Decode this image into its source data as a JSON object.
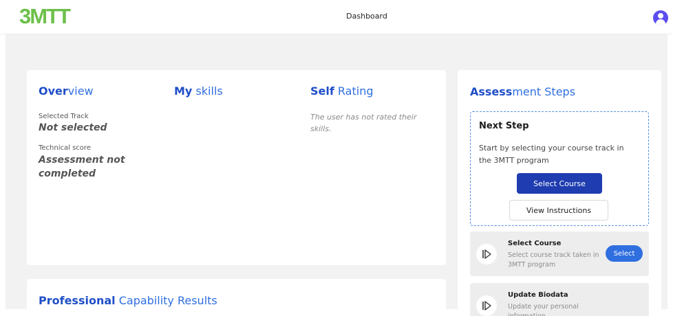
{
  "header": {
    "logo_text": "3MTT",
    "title": "Dashboard",
    "brand_color": "#6cc04a",
    "avatar_icon": "user-avatar-icon"
  },
  "overview": {
    "title_strong": "Over",
    "title_rest": "view",
    "selected_track_label": "Selected Track",
    "selected_track_value": "Not selected",
    "technical_score_label": "Technical score",
    "technical_score_value": "Assessment not completed"
  },
  "skills": {
    "title_strong": "My",
    "title_rest": " skills"
  },
  "self_rating": {
    "title_strong": "Self",
    "title_rest": " Rating",
    "empty_text": "The user has not rated their skills."
  },
  "capability": {
    "title_strong": "Professional",
    "title_rest": " Capability Results"
  },
  "assessment": {
    "title_strong": "Assess",
    "title_rest": "ment Steps",
    "next_step": {
      "title": "Next Step",
      "description": "Start by selecting your course track in the 3MTT program",
      "primary_button": "Select Course",
      "secondary_button": "View Instructions"
    },
    "steps": [
      {
        "title": "Select Course",
        "description": "Select course track taken in 3MTT program",
        "button": "Select",
        "icon": "play-step-icon"
      },
      {
        "title": "Update Biodata",
        "description": "Update your personal information",
        "icon": "play-step-icon"
      }
    ]
  },
  "colors": {
    "accent": "#2f6fe0",
    "primary_button": "#1f3db0",
    "background": "#f2f2f3"
  }
}
